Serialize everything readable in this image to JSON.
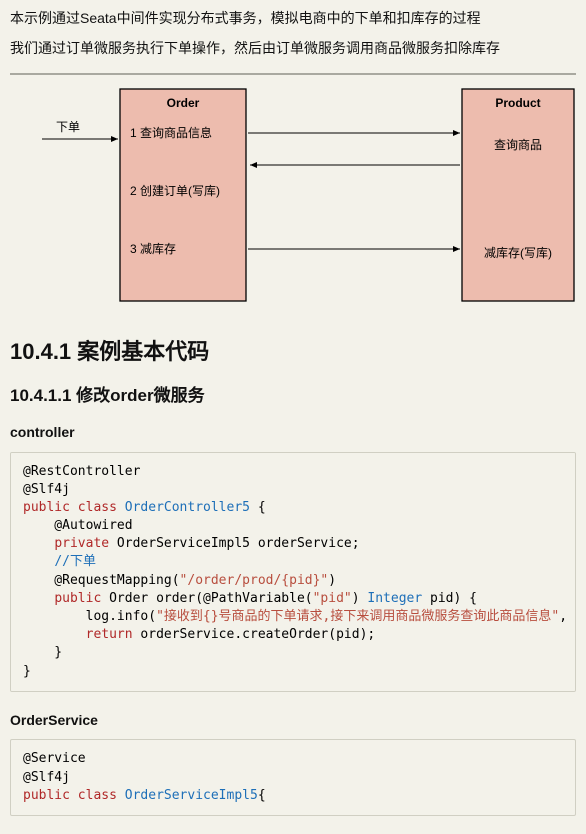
{
  "intro": {
    "p1": "本示例通过Seata中间件实现分布式事务，模拟电商中的下单和扣库存的过程",
    "p2": "我们通过订单微服务执行下单操作，然后由订单微服务调用商品微服务扣除库存"
  },
  "diagram": {
    "order_title": "Order",
    "product_title": "Product",
    "arrow_in": "下单",
    "order_step1": "1 查询商品信息",
    "order_step2": "2 创建订单(写库)",
    "order_step3": "3 减库存",
    "product_step1": "查询商品",
    "product_step2": "减库存(写库)"
  },
  "h2": "10.4.1 案例基本代码",
  "h3": "10.4.1.1 修改order微服务",
  "h4_controller": "controller",
  "h4_orderservice": "OrderService",
  "code1": {
    "ann_rest": "@RestController",
    "ann_slf": "@Slf4j",
    "kw_public": "public",
    "kw_class": "class",
    "cls_controller": "OrderController5",
    "brace_open": " {",
    "ann_autowired": "    @Autowired",
    "kw_private": "private",
    "svc_type": " OrderServiceImpl5 orderService;",
    "comment": "//下单",
    "ann_mapping": "    @RequestMapping(",
    "mapping_path": "\"/order/prod/{pid}\"",
    "mapping_close": ")",
    "sig_pre": " Order order(@PathVariable(",
    "pv_name": "\"pid\"",
    "sig_mid": ") ",
    "int_type": "Integer",
    "sig_post": " pid) {",
    "log_pre": "        log.info(",
    "log_msg": "\"接收到{}号商品的下单请求,接下来调用商品微服务查询此商品信息\"",
    "log_post": ", pid);",
    "kw_return": "return",
    "ret_line": " orderService.createOrder(pid);",
    "brace_close1": "    }",
    "brace_close2": "}"
  },
  "code2": {
    "ann_service": "@Service",
    "ann_slf": "@Slf4j",
    "kw_public": "public",
    "kw_class": "class",
    "cls_service": "OrderServiceImpl5",
    "brace_open": "{"
  }
}
